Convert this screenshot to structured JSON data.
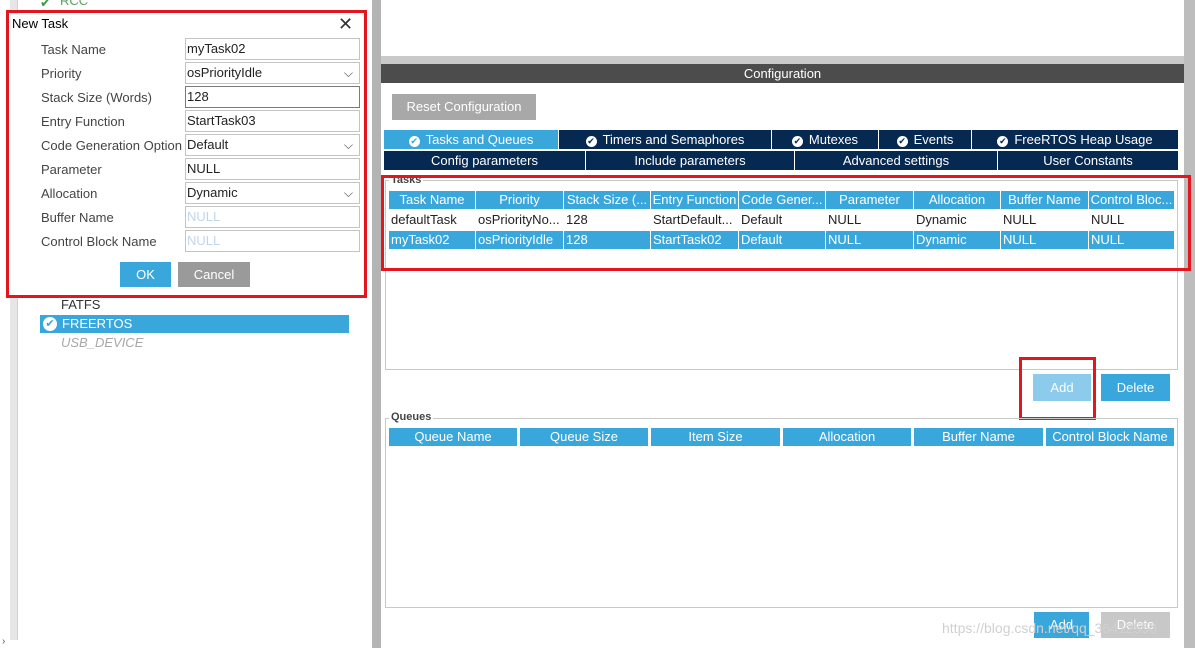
{
  "tree": {
    "rcc": "RCC",
    "fatfs": "FATFS",
    "freertos": "FREERTOS",
    "usb_device": "USB_DEVICE"
  },
  "configuration": {
    "header": "Configuration",
    "reset_button": "Reset Configuration",
    "tabs_row1": [
      "Tasks and Queues",
      "Timers and Semaphores",
      "Mutexes",
      "Events",
      "FreeRTOS Heap Usage"
    ],
    "tabs_row2": [
      "Config parameters",
      "Include parameters",
      "Advanced settings",
      "User Constants"
    ],
    "active_tab": "Tasks and Queues"
  },
  "tasks": {
    "title": "Tasks",
    "columns": [
      "Task Name",
      "Priority",
      "Stack Size (...",
      "Entry Function",
      "Code Gener...",
      "Parameter",
      "Allocation",
      "Buffer Name",
      "Control Bloc..."
    ],
    "rows": [
      [
        "defaultTask",
        "osPriorityNo...",
        "128",
        "StartDefault...",
        "Default",
        "NULL",
        "Dynamic",
        "NULL",
        "NULL"
      ],
      [
        "myTask02",
        "osPriorityIdle",
        "128",
        "StartTask02",
        "Default",
        "NULL",
        "Dynamic",
        "NULL",
        "NULL"
      ]
    ],
    "add_button": "Add",
    "delete_button": "Delete"
  },
  "queues": {
    "title": "Queues",
    "columns": [
      "Queue Name",
      "Queue Size",
      "Item Size",
      "Allocation",
      "Buffer Name",
      "Control Block Name"
    ],
    "add_button": "Add",
    "delete_button": "Delete"
  },
  "dialog": {
    "title": "New Task",
    "fields": [
      {
        "label": "Task Name",
        "value": "myTask02"
      },
      {
        "label": "Priority",
        "value": "osPriorityIdle"
      },
      {
        "label": "Stack Size (Words)",
        "value": "128"
      },
      {
        "label": "Entry Function",
        "value": "StartTask03"
      },
      {
        "label": "Code Generation Option",
        "value": "Default"
      },
      {
        "label": "Parameter",
        "value": "NULL"
      },
      {
        "label": "Allocation",
        "value": "Dynamic"
      },
      {
        "label": "Buffer Name",
        "value": "NULL"
      },
      {
        "label": "Control Block Name",
        "value": "NULL"
      }
    ],
    "ok_button": "OK",
    "cancel_button": "Cancel"
  },
  "watermark": "https://blog.csdn.net/qq_36412550",
  "colors": {
    "accent": "#39a7dc",
    "tab_dark": "#062952",
    "highlight": "#e3161d"
  }
}
